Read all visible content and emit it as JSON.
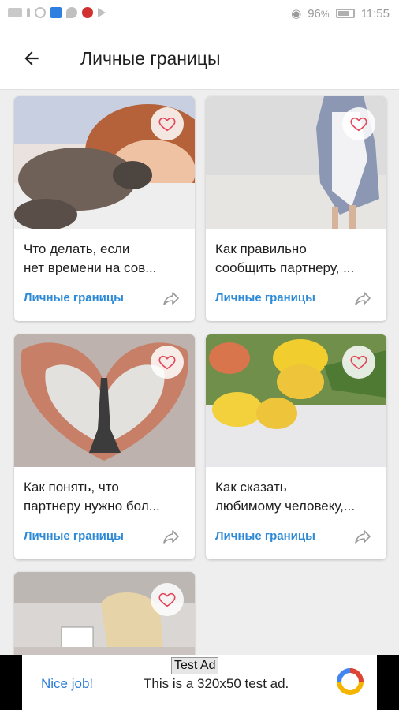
{
  "status_bar": {
    "battery": "96",
    "battery_unit": "%",
    "time": "11:55"
  },
  "header": {
    "title": "Личные границы"
  },
  "cards": [
    {
      "title_line1": "Что делать, если",
      "title_line2": "нет времени на сов...",
      "category": "Личные границы"
    },
    {
      "title_line1": "Как правильно",
      "title_line2": "сообщить партнеру, ...",
      "category": "Личные границы"
    },
    {
      "title_line1": "Как понять, что",
      "title_line2": "партнеру нужно бол...",
      "category": "Личные границы"
    },
    {
      "title_line1": "Как сказать",
      "title_line2": "любимому человеку,...",
      "category": "Личные границы"
    }
  ],
  "ad": {
    "tag": "Test Ad",
    "cta": "Nice job!",
    "text": "This is a 320x50 test ad."
  },
  "colors": {
    "accent": "#2e8ad6",
    "heart": "#e2465a"
  }
}
